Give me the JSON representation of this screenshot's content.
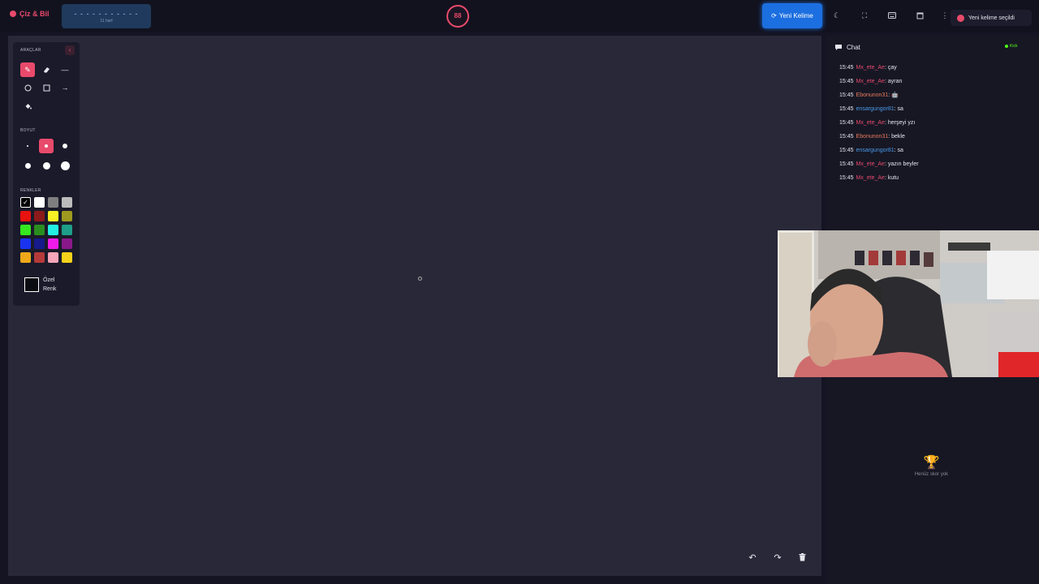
{
  "header": {
    "logo": "Çiz & Bil",
    "word_mask": "- - - - - - - - - - -",
    "word_length": "11 harf",
    "timer": "88",
    "new_word_button": "Yeni Kelime",
    "toast": "Yeni kelime seçildi"
  },
  "tools": {
    "title": "ARAÇLAR",
    "size_title": "BOYUT",
    "colors_title": "RENKLER",
    "custom_color_line1": "Özel",
    "custom_color_line2": "Renk",
    "selected_tool": "pen",
    "selected_size": 2,
    "colors": [
      "#000000",
      "#ffffff",
      "#7f7f7f",
      "#bcbcbc",
      "#e8120e",
      "#8b1a1a",
      "#f7f024",
      "#9e9a1f",
      "#35e81f",
      "#2a8e1f",
      "#22f0e3",
      "#1e9e8a",
      "#1a33f0",
      "#161a8a",
      "#f01ae8",
      "#8a188a",
      "#f0a81a",
      "#b53a3a",
      "#f5a6b8",
      "#f7d21a"
    ]
  },
  "chat": {
    "title": "Chat",
    "platform": "Kick",
    "messages": [
      {
        "time": "15:45",
        "user": "Mx_ete_Ae",
        "user_color": "#e84a6b",
        "text": "çay"
      },
      {
        "time": "15:45",
        "user": "Mx_ete_Ae",
        "user_color": "#e84a6b",
        "text": "ayran"
      },
      {
        "time": "15:45",
        "user": "Ebonunon31",
        "user_color": "#e87a5a",
        "text": "🤖"
      },
      {
        "time": "15:45",
        "user": "ensargungor81",
        "user_color": "#4a9ae8",
        "text": "sa"
      },
      {
        "time": "15:45",
        "user": "Mx_ete_Ae",
        "user_color": "#e84a6b",
        "text": "herşeyi yzı"
      },
      {
        "time": "15:45",
        "user": "Ebonunon31",
        "user_color": "#e87a5a",
        "text": "bekle"
      },
      {
        "time": "15:45",
        "user": "ensargungor81",
        "user_color": "#4a9ae8",
        "text": "sa"
      },
      {
        "time": "15:45",
        "user": "Mx_ete_Ae",
        "user_color": "#e84a6b",
        "text": "yazın beyler"
      },
      {
        "time": "15:45",
        "user": "Mx_ete_Ae",
        "user_color": "#e84a6b",
        "text": "kutu"
      }
    ]
  },
  "scoreboard": {
    "empty_text": "Henüz skor yok"
  }
}
